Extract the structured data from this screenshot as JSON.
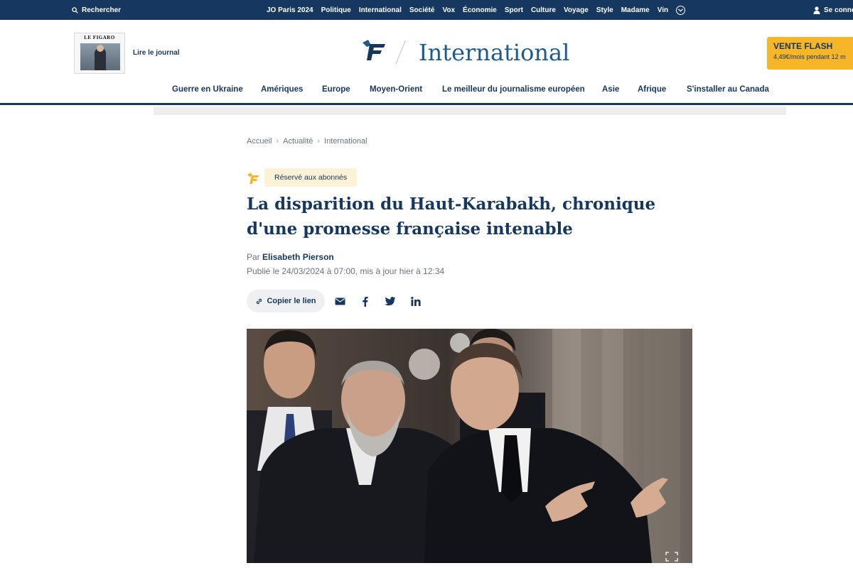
{
  "topbar": {
    "search_label": "Rechercher",
    "menu": [
      "JO Paris 2024",
      "Politique",
      "International",
      "Société",
      "Vox",
      "Économie",
      "Sport",
      "Culture",
      "Voyage",
      "Style",
      "Madame",
      "Vin"
    ],
    "login_label": "Se conne"
  },
  "header": {
    "journal_masthead": "LE FIGARO",
    "read_journal": "Lire le journal",
    "section_title": "International",
    "flash": {
      "title": "VENTE FLASH",
      "subtitle": "4,49€/mois pendant 12 m"
    },
    "subnav": [
      "Guerre en Ukraine",
      "Amériques",
      "Europe",
      "Moyen-Orient",
      "Le meilleur du journalisme européen",
      "Asie",
      "Afrique",
      "S'installer au Canada"
    ]
  },
  "article": {
    "breadcrumb": [
      "Accueil",
      "Actualité",
      "International"
    ],
    "badge": "Réservé aux abonnés",
    "headline": "La disparition du Haut-Karabakh, chronique d'une promesse française intenable",
    "byline_prefix": "Par",
    "author": "Elisabeth Pierson",
    "published": "Publié le 24/03/2024 à 07:00, mis à jour hier à 12:34",
    "copy_link": "Copier le lien",
    "share_icons": [
      "mail-icon",
      "facebook-icon",
      "twitter-icon",
      "linkedin-icon"
    ]
  },
  "colors": {
    "brand_navy": "#163860",
    "section_blue": "#1d5a8e",
    "flash_yellow": "#f7b528",
    "badge_bg": "#fdf1d6"
  }
}
